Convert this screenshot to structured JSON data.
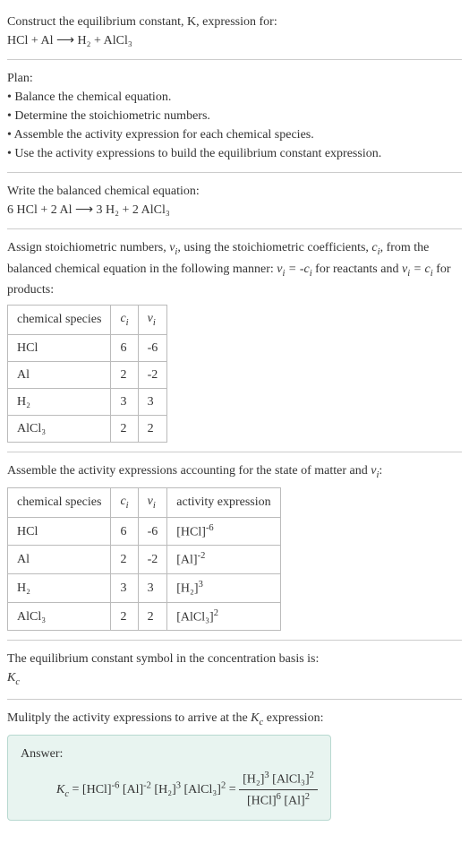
{
  "header": {
    "title_line1": "Construct the equilibrium constant, K, expression for:",
    "equation": "HCl + Al ⟶ H₂ + AlCl₃"
  },
  "plan": {
    "title": "Plan:",
    "items": [
      "• Balance the chemical equation.",
      "• Determine the stoichiometric numbers.",
      "• Assemble the activity expression for each chemical species.",
      "• Use the activity expressions to build the equilibrium constant expression."
    ]
  },
  "balanced": {
    "title": "Write the balanced chemical equation:",
    "equation": "6 HCl + 2 Al ⟶ 3 H₂ + 2 AlCl₃"
  },
  "stoich": {
    "intro_part1": "Assign stoichiometric numbers, ",
    "intro_part2": ", using the stoichiometric coefficients, ",
    "intro_part3": ", from the balanced chemical equation in the following manner: ",
    "intro_part4": " for reactants and ",
    "intro_part5": " for products:",
    "table": {
      "headers": [
        "chemical species",
        "cᵢ",
        "νᵢ"
      ],
      "rows": [
        {
          "species": "HCl",
          "ci": "6",
          "vi": "-6"
        },
        {
          "species": "Al",
          "ci": "2",
          "vi": "-2"
        },
        {
          "species": "H₂",
          "ci": "3",
          "vi": "3"
        },
        {
          "species": "AlCl₃",
          "ci": "2",
          "vi": "2"
        }
      ]
    }
  },
  "activity": {
    "intro": "Assemble the activity expressions accounting for the state of matter and νᵢ:",
    "table": {
      "headers": [
        "chemical species",
        "cᵢ",
        "νᵢ",
        "activity expression"
      ],
      "rows": [
        {
          "species": "HCl",
          "ci": "6",
          "vi": "-6",
          "expr_base": "[HCl]",
          "expr_exp": "-6"
        },
        {
          "species": "Al",
          "ci": "2",
          "vi": "-2",
          "expr_base": "[Al]",
          "expr_exp": "-2"
        },
        {
          "species": "H₂",
          "ci": "3",
          "vi": "3",
          "expr_base": "[H₂]",
          "expr_exp": "3"
        },
        {
          "species": "AlCl₃",
          "ci": "2",
          "vi": "2",
          "expr_base": "[AlCl₃]",
          "expr_exp": "2"
        }
      ]
    }
  },
  "symbol": {
    "line1": "The equilibrium constant symbol in the concentration basis is:",
    "line2": "K",
    "line2_sub": "c"
  },
  "multiply": {
    "intro_part1": "Mulitply the activity expressions to arrive at the ",
    "intro_part2": " expression:"
  },
  "answer": {
    "label": "Answer:",
    "lhs_k": "K",
    "lhs_sub": "c",
    "terms": [
      {
        "base": "[HCl]",
        "exp": "-6"
      },
      {
        "base": "[Al]",
        "exp": "-2"
      },
      {
        "base": "[H₂]",
        "exp": "3"
      },
      {
        "base": "[AlCl₃]",
        "exp": "2"
      }
    ],
    "frac_num": [
      {
        "base": "[H₂]",
        "exp": "3"
      },
      {
        "base": "[AlCl₃]",
        "exp": "2"
      }
    ],
    "frac_den": [
      {
        "base": "[HCl]",
        "exp": "6"
      },
      {
        "base": "[Al]",
        "exp": "2"
      }
    ]
  }
}
